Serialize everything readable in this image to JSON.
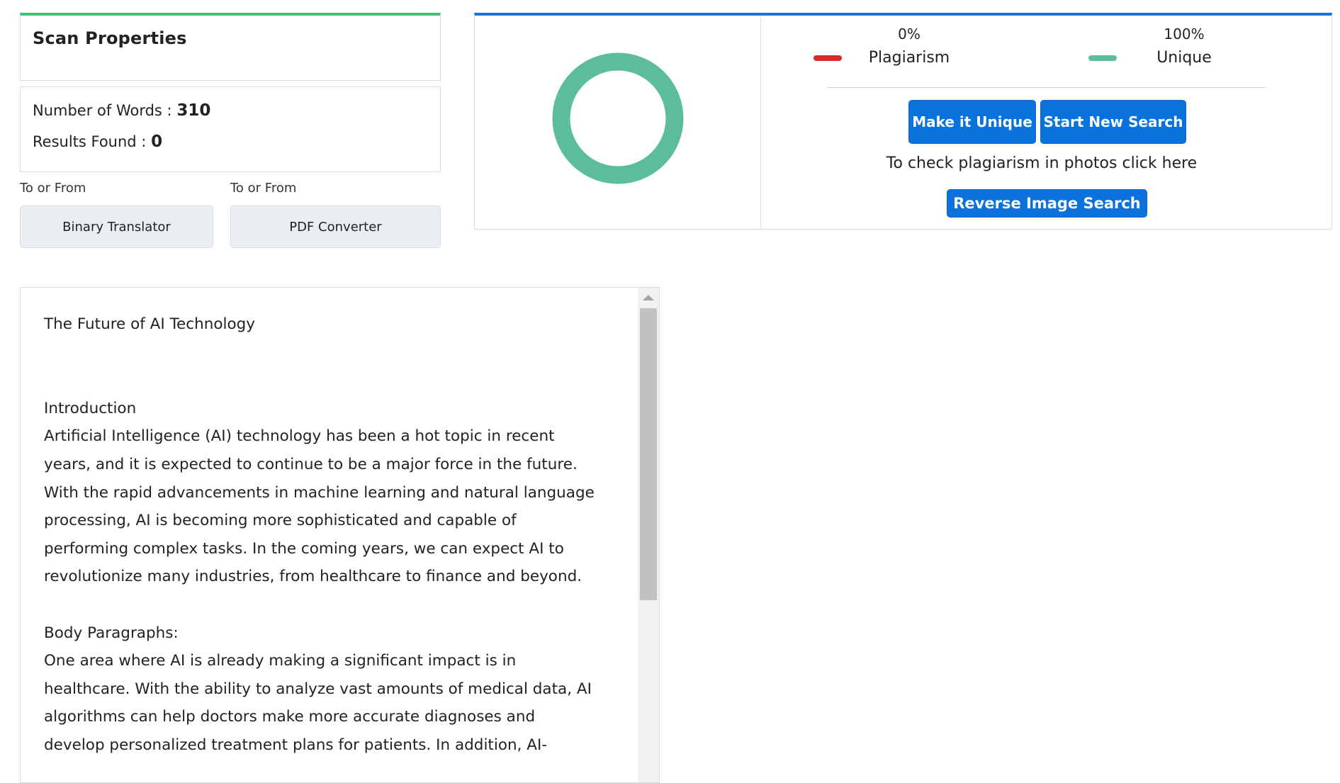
{
  "scan_properties": {
    "title": "Scan Properties",
    "words_label": "Number of Words :",
    "words_value": "310",
    "results_label": "Results Found :",
    "results_value": "0"
  },
  "tools": [
    {
      "caption": "To or From",
      "label": "Binary Translator"
    },
    {
      "caption": "To or From",
      "label": "PDF Converter"
    }
  ],
  "result": {
    "plagiarism": {
      "percent_text": "0%",
      "label": "Plagiarism",
      "value": 0,
      "color": "#d62b2b"
    },
    "unique": {
      "percent_text": "100%",
      "label": "Unique",
      "value": 100,
      "color": "#5bbd9c"
    },
    "make_unique_label": "Make it Unique",
    "new_search_label": "Start New Search",
    "photo_text": "To check plagiarism in photos click here",
    "reverse_image_label": "Reverse Image Search"
  },
  "document": {
    "text": "The Future of AI Technology\n\n\nIntroduction\nArtificial Intelligence (AI) technology has been a hot topic in recent\nyears, and it is expected to continue to be a major force in the future.\nWith the rapid advancements in machine learning and natural language\nprocessing, AI is becoming more sophisticated and capable of\nperforming complex tasks. In the coming years, we can expect AI to\nrevolutionize many industries, from healthcare to finance and beyond.\n\nBody Paragraphs:\nOne area where AI is already making a significant impact is in\nhealthcare. With the ability to analyze vast amounts of medical data, AI\nalgorithms can help doctors make more accurate diagnoses and\ndevelop personalized treatment plans for patients. In addition, AI-"
  },
  "colors": {
    "scan_accent": "#3ec27a",
    "result_accent": "#1a73d9",
    "button_blue": "#0b72dc"
  }
}
